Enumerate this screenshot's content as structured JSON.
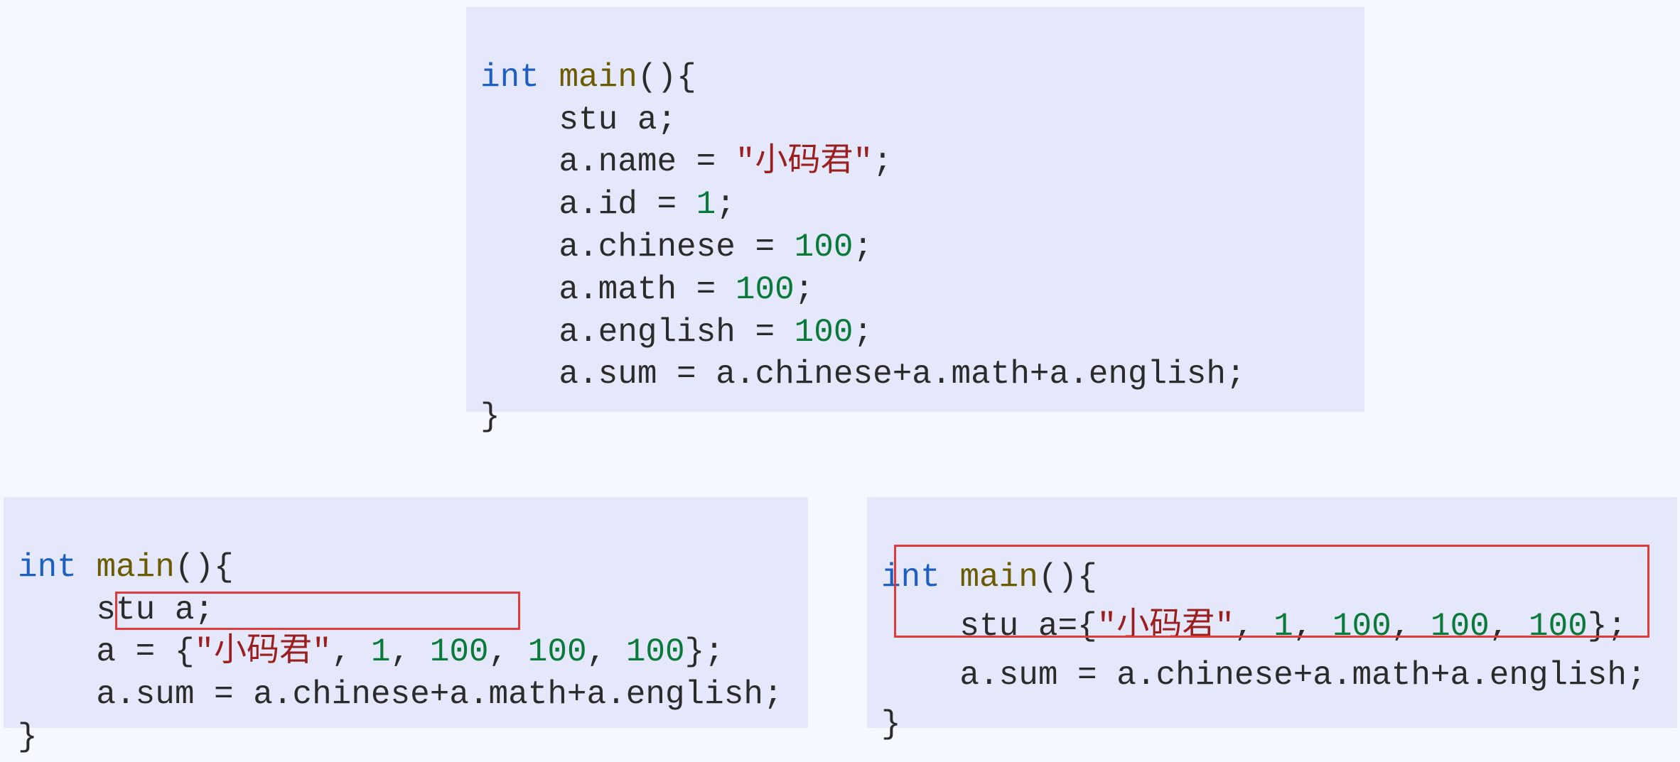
{
  "code1": {
    "l1a": "int",
    "l1b": " ",
    "l1c": "main",
    "l1d": "(){",
    "l2": "    stu a;",
    "l3a": "    a.name = ",
    "l3b": "\"小码君\"",
    "l3c": ";",
    "l4a": "    a.id = ",
    "l4b": "1",
    "l4c": ";",
    "l5a": "    a.chinese = ",
    "l5b": "100",
    "l5c": ";",
    "l6a": "    a.math = ",
    "l6b": "100",
    "l6c": ";",
    "l7a": "    a.english = ",
    "l7b": "100",
    "l7c": ";",
    "l8": "    a.sum = a.chinese+a.math+a.english;",
    "l9": "}"
  },
  "code2": {
    "l1a": "int",
    "l1b": " ",
    "l1c": "main",
    "l1d": "(){",
    "l2": "    stu a;",
    "l3a": "    a = {",
    "l3b": "\"小码君\"",
    "l3c": ", ",
    "l3d": "1",
    "l3e": ", ",
    "l3f": "100",
    "l3g": ", ",
    "l3h": "100",
    "l3i": ", ",
    "l3j": "100",
    "l3k": "};",
    "l4": "    a.sum = a.chinese+a.math+a.english;",
    "l5": "}"
  },
  "code3": {
    "l1a": "int",
    "l1b": " ",
    "l1c": "main",
    "l1d": "(){",
    "l2a": "    stu a={",
    "l2b": "\"小码君\"",
    "l2c": ", ",
    "l2d": "1",
    "l2e": ", ",
    "l2f": "100",
    "l2g": ", ",
    "l2h": "100",
    "l2i": ", ",
    "l2j": "100",
    "l2k": "};",
    "l3": "    a.sum = a.chinese+a.math+a.english;",
    "l4": "}"
  }
}
